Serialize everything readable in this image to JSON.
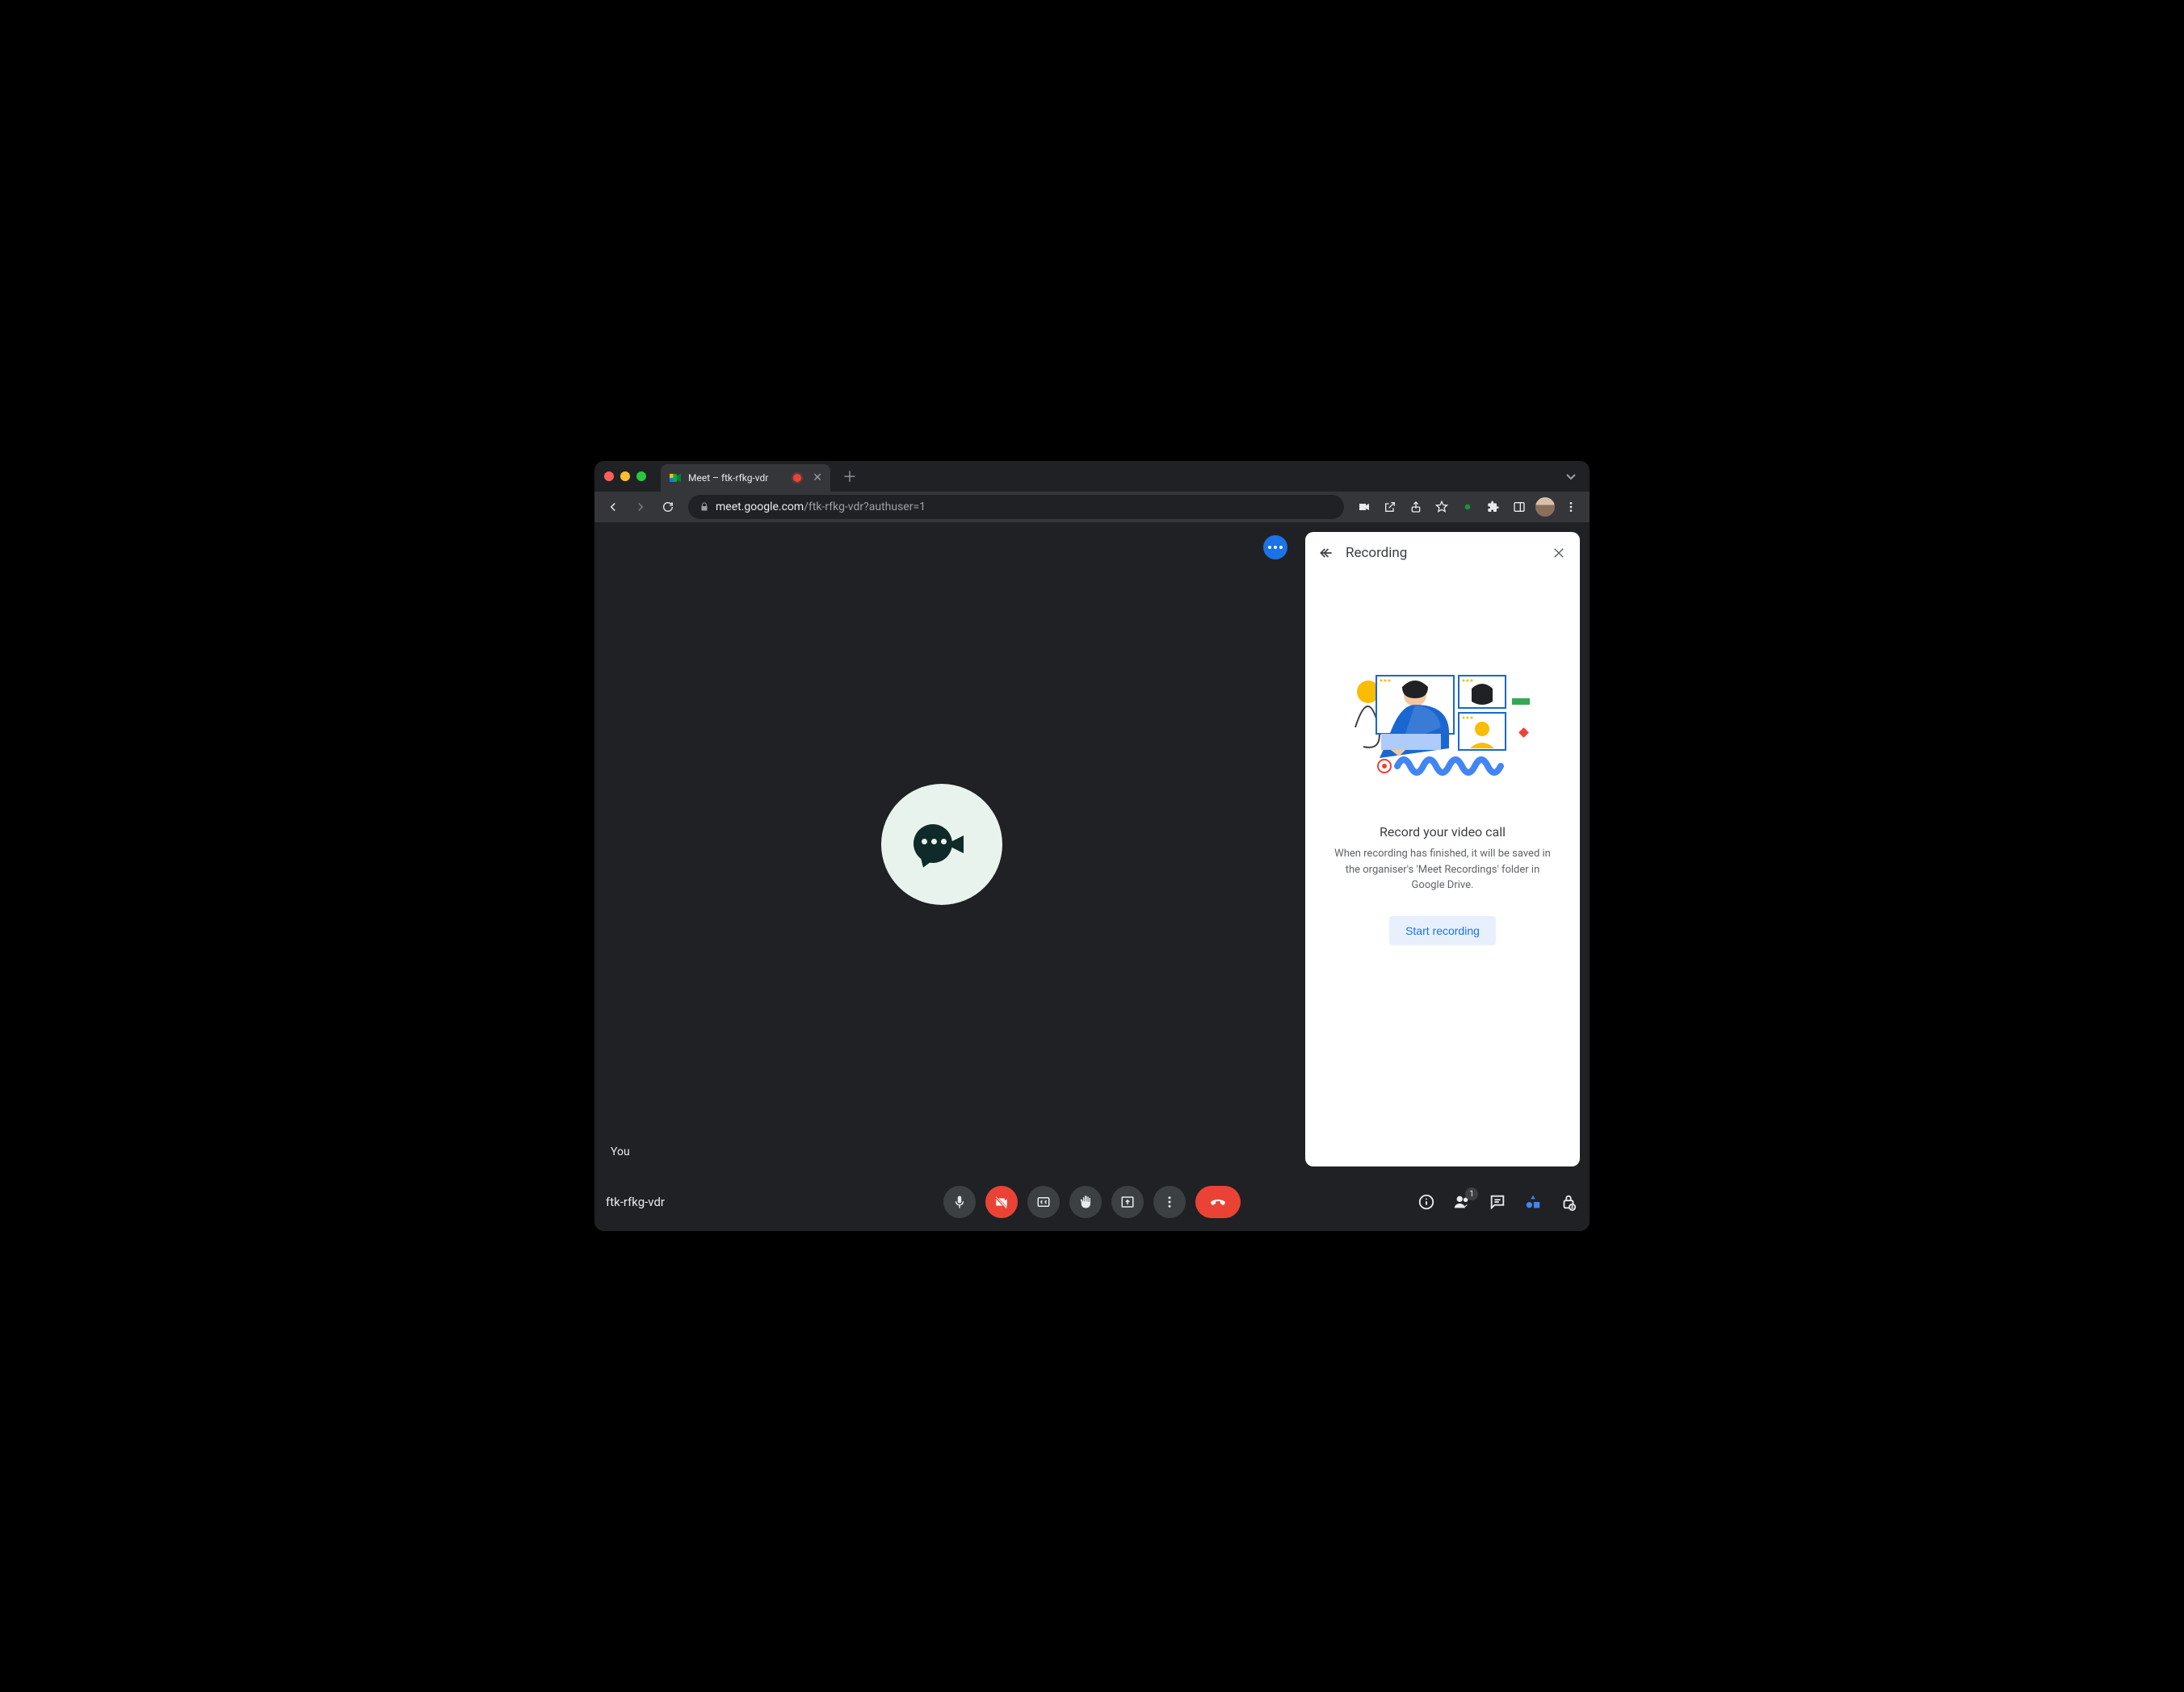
{
  "browser": {
    "tab_title": "Meet – ftk-rfkg-vdr",
    "url_host": "meet.google.com",
    "url_path": "/ftk-rfkg-vdr?authuser=1"
  },
  "meeting": {
    "self_label": "You",
    "code": "ftk-rfkg-vdr",
    "participant_count": "1"
  },
  "panel": {
    "title": "Recording",
    "heading": "Record your video call",
    "body": "When recording has finished, it will be saved in the organiser's 'Meet Recordings' folder in Google Drive.",
    "cta": "Start recording"
  }
}
